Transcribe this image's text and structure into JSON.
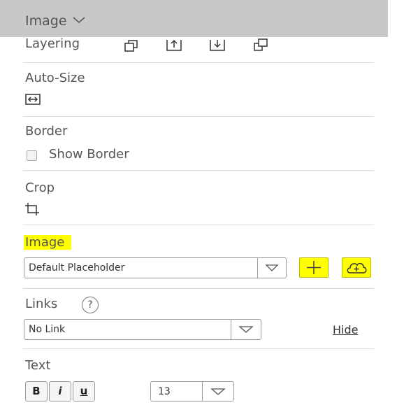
{
  "header": {
    "title": "Image"
  },
  "layering": {
    "label": "Layering"
  },
  "autosize": {
    "label": "Auto-Size"
  },
  "border": {
    "label": "Border",
    "checkbox_label": "Show Border",
    "checked": false
  },
  "crop": {
    "label": "Crop"
  },
  "image": {
    "label": "Image",
    "select_value": "Default Placeholder",
    "highlight_color": "#ffff00"
  },
  "links": {
    "label": "Links",
    "help_glyph": "?",
    "select_value": "No Link",
    "hide_label": "Hide"
  },
  "text": {
    "label": "Text",
    "bold": "B",
    "italic": "i",
    "underline": "u",
    "font_size": "13"
  }
}
